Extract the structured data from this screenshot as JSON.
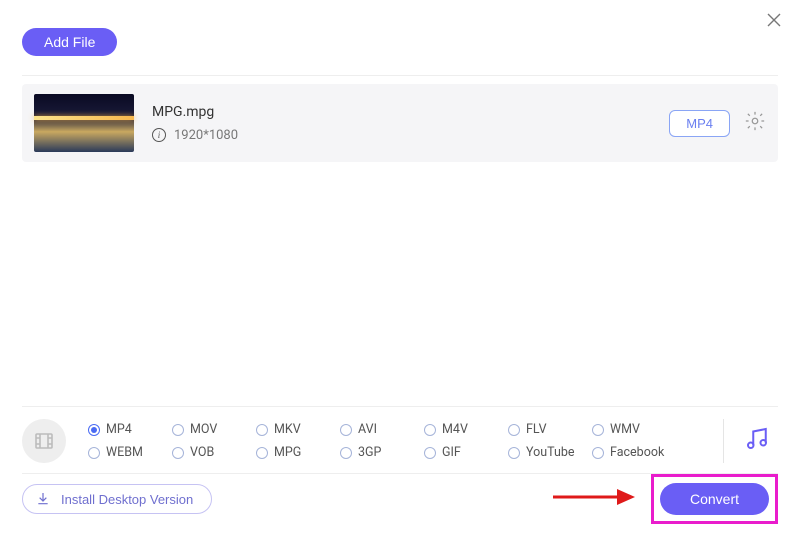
{
  "header": {
    "add_file_label": "Add File"
  },
  "file": {
    "name": "MPG.mpg",
    "resolution": "1920*1080",
    "target_format": "MP4"
  },
  "formats": {
    "selected": "MP4",
    "row1": [
      "MP4",
      "MOV",
      "MKV",
      "AVI",
      "M4V",
      "FLV",
      "WMV"
    ],
    "row2": [
      "WEBM",
      "VOB",
      "MPG",
      "3GP",
      "GIF",
      "YouTube",
      "Facebook"
    ]
  },
  "footer": {
    "install_label": "Install Desktop Version",
    "convert_label": "Convert"
  }
}
